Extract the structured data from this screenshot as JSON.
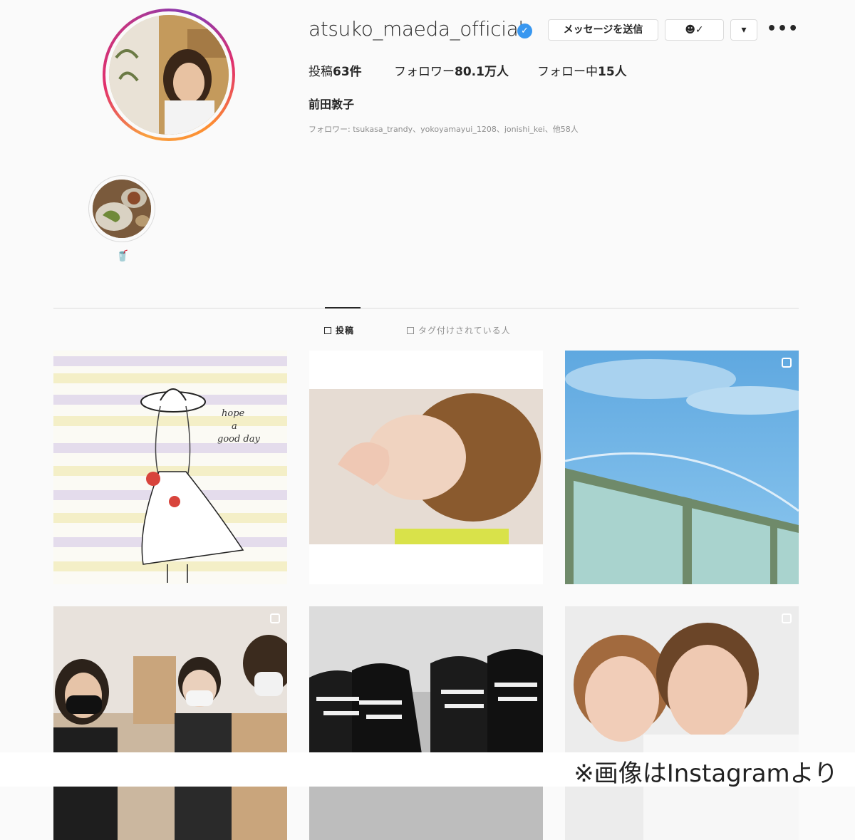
{
  "profile": {
    "username": "atsuko_maeda_official",
    "verified_icon": "verified-badge-icon",
    "message_button": "メッセージを送信",
    "follow_icon": "person-check-icon",
    "dropdown_icon": "caret-down-icon",
    "more_icon": "ellipsis-icon",
    "more_glyph": "•••",
    "stats": {
      "posts_label": "投稿",
      "posts_value": "63件",
      "followers_label": "フォロワー",
      "followers_value": "80.1万人",
      "following_label": "フォロー中",
      "following_value": "15人"
    },
    "full_name": "前田敦子",
    "followed_by": "フォロワー: tsukasa_trandy、yokoyamayui_1208、jonishi_kei、他58人"
  },
  "highlights": [
    {
      "label": "🥤",
      "icon": "drink-cup-icon"
    }
  ],
  "tabs": [
    {
      "label": "投稿",
      "icon": "grid-icon",
      "active": true
    },
    {
      "label": "タグ付けされている人",
      "icon": "tag-person-icon",
      "active": false
    }
  ],
  "grid": [
    {
      "name": "illustration-girl-hat",
      "handwritten_text": [
        "hope",
        "a",
        "good day"
      ],
      "multi": false
    },
    {
      "name": "short-hair-portrait",
      "multi": false
    },
    {
      "name": "sky-rainbow",
      "multi": true
    },
    {
      "name": "friends-with-bags",
      "multi": true
    },
    {
      "name": "sneakers-bw",
      "multi": false
    },
    {
      "name": "two-women-selfie",
      "multi": true
    }
  ],
  "caption": "※画像はInstagramより",
  "colors": {
    "verified": "#3897f0",
    "ring_start": "#f9a03f",
    "ring_end": "#c13584",
    "muted_text": "#8e8e8e",
    "border": "#dbdbdb"
  }
}
